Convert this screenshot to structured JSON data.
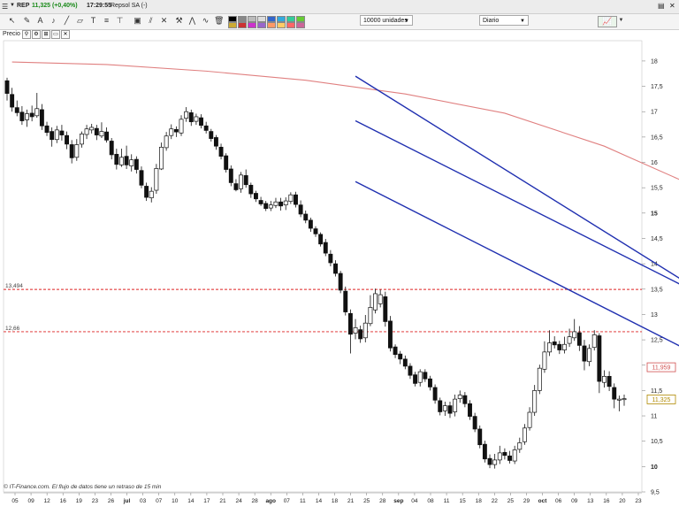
{
  "topbar": {
    "symbol": "REP",
    "price_change": "11,325 (+0,40%)",
    "time": "17:29:55",
    "name": "Repsol SA (-)"
  },
  "toolbar": {
    "units_select": "10000 unidades",
    "period_select": "Diario",
    "tools": [
      "cursor-icon",
      "pencil-icon",
      "text-icon",
      "bell-icon",
      "line-icon",
      "eraser-icon",
      "text-tool-icon",
      "fibonacci-icon",
      "measure-icon",
      "copy-icon",
      "trash-icon"
    ],
    "colors": [
      "#000000",
      "#888888",
      "#bbbbbb",
      "#dddddd",
      "#3366cc",
      "#33aadd",
      "#33cc99",
      "#66cc33",
      "#ccaa33",
      "#cc3333",
      "#cc33cc",
      "#9966cc",
      "#ff9966",
      "#ffcc66",
      "#ff6666",
      "#cc6699"
    ],
    "accent": "#2a2a2a"
  },
  "header": {
    "label": "Precio"
  },
  "footer": {
    "note": "© IT-Finance.com. El flujo de datos tiene un retraso de 15 min"
  },
  "chart_data": {
    "type": "candlestick",
    "y_ticks": [
      "18",
      "17,5",
      "17",
      "16,5",
      "16",
      "15,5",
      "15",
      "14,5",
      "14",
      "13,5",
      "13",
      "12,5",
      "12",
      "11,5",
      "11",
      "10,5",
      "10",
      "9,5"
    ],
    "ylim": [
      9.5,
      18.4
    ],
    "x_ticks": [
      "05",
      "09",
      "12",
      "16",
      "19",
      "23",
      "26",
      "jul",
      "03",
      "07",
      "10",
      "14",
      "17",
      "21",
      "24",
      "28",
      "ago",
      "07",
      "11",
      "14",
      "18",
      "21",
      "25",
      "28",
      "sep",
      "04",
      "08",
      "11",
      "15",
      "18",
      "22",
      "25",
      "29",
      "oct",
      "06",
      "09",
      "13",
      "16",
      "20",
      "23"
    ],
    "hlines": [
      {
        "label": "13,494",
        "value": 13.494,
        "color": "#dd2222"
      },
      {
        "label": "12,66",
        "value": 12.66,
        "color": "#dd2222"
      }
    ],
    "price_labels": [
      {
        "text": "11,959",
        "value": 11.959,
        "color": "#d05050"
      },
      {
        "text": "11,325",
        "value": 11.325,
        "color": "#b08a00"
      }
    ],
    "moving_average": {
      "color": "#e08080",
      "x": [
        1,
        20,
        40,
        60,
        80,
        100,
        120,
        125,
        140,
        160,
        180,
        200,
        220,
        240
      ],
      "y": [
        17.98,
        17.93,
        17.8,
        17.62,
        17.35,
        16.97,
        16.32,
        16.1,
        15.45,
        14.7,
        13.9,
        12.9,
        12.45,
        11.96
      ]
    },
    "channels": [
      {
        "x": [
          70,
          168
        ],
        "y": [
          17.7,
          11.7
        ],
        "color": "#1f2fb0"
      },
      {
        "x": [
          70,
          208
        ],
        "y": [
          16.82,
          10.0
        ],
        "color": "#1f2fb0"
      },
      {
        "x": [
          70,
          193
        ],
        "y": [
          15.62,
          9.5
        ],
        "color": "#1f2fb0"
      }
    ],
    "candles": [
      [
        17.61,
        17.36,
        17.67,
        17.22
      ],
      [
        17.34,
        17.09,
        17.47,
        17.0
      ],
      [
        17.08,
        16.98,
        17.22,
        16.91
      ],
      [
        16.99,
        16.82,
        17.11,
        16.74
      ],
      [
        16.84,
        16.96,
        17.04,
        16.7
      ],
      [
        16.97,
        16.9,
        17.12,
        16.81
      ],
      [
        16.92,
        17.06,
        17.37,
        16.88
      ],
      [
        17.04,
        16.72,
        17.15,
        16.64
      ],
      [
        16.72,
        16.59,
        16.8,
        16.52
      ],
      [
        16.61,
        16.45,
        16.69,
        16.31
      ],
      [
        16.45,
        16.64,
        16.72,
        16.38
      ],
      [
        16.62,
        16.54,
        16.74,
        16.43
      ],
      [
        16.53,
        16.36,
        16.61,
        16.26
      ],
      [
        16.35,
        16.09,
        16.44,
        15.98
      ],
      [
        16.1,
        16.35,
        16.46,
        16.03
      ],
      [
        16.36,
        16.56,
        16.61,
        16.29
      ],
      [
        16.55,
        16.66,
        16.74,
        16.46
      ],
      [
        16.64,
        16.69,
        16.76,
        16.57
      ],
      [
        16.67,
        16.54,
        16.74,
        16.44
      ],
      [
        16.52,
        16.61,
        16.79,
        16.48
      ],
      [
        16.6,
        16.44,
        16.69,
        16.39
      ],
      [
        16.42,
        16.15,
        16.48,
        16.06
      ],
      [
        16.16,
        15.96,
        16.27,
        15.86
      ],
      [
        15.95,
        16.1,
        16.27,
        15.91
      ],
      [
        16.12,
        15.95,
        16.33,
        15.87
      ],
      [
        15.93,
        16.05,
        16.16,
        15.82
      ],
      [
        16.06,
        15.86,
        16.12,
        15.78
      ],
      [
        15.84,
        15.55,
        15.92,
        15.49
      ],
      [
        15.53,
        15.31,
        15.6,
        15.24
      ],
      [
        15.3,
        15.43,
        15.51,
        15.21
      ],
      [
        15.45,
        15.88,
        15.97,
        15.38
      ],
      [
        15.87,
        16.3,
        16.39,
        15.85
      ],
      [
        16.29,
        16.52,
        16.6,
        16.23
      ],
      [
        16.53,
        16.66,
        16.75,
        16.46
      ],
      [
        16.65,
        16.6,
        16.71,
        16.5
      ],
      [
        16.58,
        16.85,
        16.93,
        16.52
      ],
      [
        16.87,
        17.0,
        17.09,
        16.8
      ],
      [
        16.98,
        16.8,
        17.04,
        16.72
      ],
      [
        16.81,
        16.9,
        16.96,
        16.74
      ],
      [
        16.88,
        16.73,
        16.95,
        16.67
      ],
      [
        16.72,
        16.63,
        16.8,
        16.57
      ],
      [
        16.61,
        16.47,
        16.66,
        16.41
      ],
      [
        16.49,
        16.32,
        16.54,
        16.25
      ],
      [
        16.3,
        16.12,
        16.37,
        16.06
      ],
      [
        16.13,
        15.86,
        16.18,
        15.8
      ],
      [
        15.87,
        15.6,
        15.94,
        15.53
      ],
      [
        15.58,
        15.46,
        15.67,
        15.43
      ],
      [
        15.48,
        15.75,
        15.81,
        15.4
      ],
      [
        15.74,
        15.56,
        15.86,
        15.5
      ],
      [
        15.55,
        15.38,
        15.6,
        15.3
      ],
      [
        15.39,
        15.28,
        15.44,
        15.22
      ],
      [
        15.25,
        15.18,
        15.32,
        15.14
      ],
      [
        15.19,
        15.09,
        15.24,
        15.04
      ],
      [
        15.1,
        15.16,
        15.24,
        15.04
      ],
      [
        15.15,
        15.22,
        15.3,
        15.1
      ],
      [
        15.22,
        15.14,
        15.3,
        15.05
      ],
      [
        15.16,
        15.24,
        15.31,
        15.06
      ],
      [
        15.23,
        15.36,
        15.41,
        15.18
      ],
      [
        15.36,
        15.17,
        15.42,
        15.11
      ],
      [
        15.16,
        14.98,
        15.25,
        14.92
      ],
      [
        14.98,
        14.86,
        15.05,
        14.8
      ],
      [
        14.86,
        14.7,
        14.91,
        14.63
      ],
      [
        14.69,
        14.59,
        14.74,
        14.53
      ],
      [
        14.58,
        14.39,
        14.62,
        14.34
      ],
      [
        14.42,
        14.21,
        14.49,
        14.15
      ],
      [
        14.19,
        14.02,
        14.27,
        13.95
      ],
      [
        14.0,
        13.81,
        14.07,
        13.75
      ],
      [
        13.81,
        13.48,
        13.86,
        13.42
      ],
      [
        13.46,
        13.05,
        13.55,
        12.98
      ],
      [
        13.02,
        12.61,
        13.1,
        12.23
      ],
      [
        12.63,
        12.74,
        12.91,
        12.51
      ],
      [
        12.7,
        12.52,
        12.78,
        12.44
      ],
      [
        12.54,
        12.83,
        12.99,
        12.45
      ],
      [
        12.82,
        13.14,
        13.38,
        12.77
      ],
      [
        13.09,
        13.41,
        13.51,
        13.02
      ],
      [
        13.21,
        13.39,
        13.49,
        13.14
      ],
      [
        13.35,
        12.86,
        13.45,
        12.76
      ],
      [
        12.87,
        12.34,
        12.97,
        12.27
      ],
      [
        12.36,
        12.21,
        12.41,
        12.14
      ],
      [
        12.22,
        12.12,
        12.28,
        12.02
      ],
      [
        12.12,
        11.98,
        12.19,
        11.92
      ],
      [
        11.98,
        11.8,
        12.04,
        11.73
      ],
      [
        11.81,
        11.64,
        11.87,
        11.58
      ],
      [
        11.66,
        11.87,
        11.92,
        11.58
      ],
      [
        11.86,
        11.73,
        11.92,
        11.67
      ],
      [
        11.73,
        11.57,
        11.79,
        11.5
      ],
      [
        11.56,
        11.31,
        11.62,
        11.24
      ],
      [
        11.3,
        11.08,
        11.36,
        11.01
      ],
      [
        11.1,
        11.2,
        11.28,
        11.0
      ],
      [
        11.2,
        11.05,
        11.28,
        10.96
      ],
      [
        11.08,
        11.33,
        11.42,
        10.99
      ],
      [
        11.34,
        11.41,
        11.5,
        11.26
      ],
      [
        11.4,
        11.24,
        11.47,
        11.17
      ],
      [
        11.24,
        10.99,
        11.31,
        10.92
      ],
      [
        10.99,
        10.74,
        11.06,
        10.68
      ],
      [
        10.74,
        10.43,
        10.81,
        10.36
      ],
      [
        10.44,
        10.15,
        10.51,
        10.08
      ],
      [
        10.16,
        10.04,
        10.24,
        9.97
      ],
      [
        10.04,
        10.13,
        10.25,
        9.96
      ],
      [
        10.13,
        10.27,
        10.41,
        10.05
      ],
      [
        10.28,
        10.22,
        10.36,
        10.14
      ],
      [
        10.21,
        10.12,
        10.31,
        10.06
      ],
      [
        10.11,
        10.33,
        10.41,
        10.05
      ],
      [
        10.34,
        10.47,
        10.57,
        10.27
      ],
      [
        10.49,
        10.76,
        10.84,
        10.43
      ],
      [
        10.77,
        11.07,
        11.17,
        10.71
      ],
      [
        11.07,
        11.5,
        11.61,
        11.0
      ],
      [
        11.5,
        11.94,
        12.01,
        11.43
      ],
      [
        11.92,
        12.26,
        12.47,
        11.85
      ],
      [
        12.26,
        12.44,
        12.69,
        12.18
      ],
      [
        12.46,
        12.4,
        12.57,
        12.33
      ],
      [
        12.41,
        12.3,
        12.48,
        12.22
      ],
      [
        12.3,
        12.41,
        12.56,
        12.23
      ],
      [
        12.43,
        12.56,
        12.72,
        12.36
      ],
      [
        12.54,
        12.66,
        12.91,
        12.48
      ],
      [
        12.64,
        12.39,
        12.77,
        12.28
      ],
      [
        12.38,
        12.08,
        12.5,
        11.9
      ],
      [
        12.07,
        12.33,
        12.41,
        11.98
      ],
      [
        12.35,
        12.6,
        12.69,
        12.29
      ],
      [
        12.58,
        11.68,
        12.63,
        11.45
      ],
      [
        11.66,
        11.78,
        11.9,
        11.56
      ],
      [
        11.78,
        11.58,
        11.88,
        11.49
      ],
      [
        11.56,
        11.33,
        11.64,
        11.15
      ],
      [
        11.31,
        11.33,
        11.4,
        11.09
      ],
      [
        11.32,
        11.34,
        11.42,
        11.2
      ]
    ]
  }
}
